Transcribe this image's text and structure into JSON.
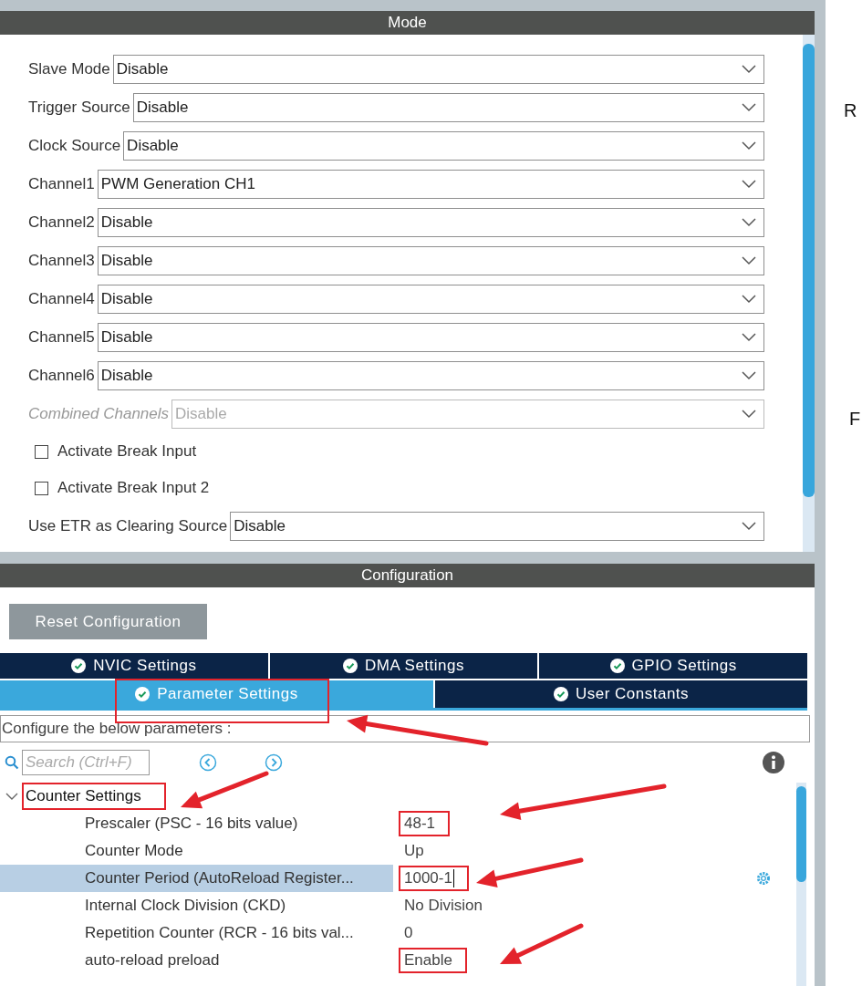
{
  "mode_panel": {
    "title": "Mode",
    "fields": [
      {
        "kind": "select",
        "label": "Slave Mode",
        "value": "Disable",
        "disabled": false
      },
      {
        "kind": "select",
        "label": "Trigger Source",
        "value": "Disable",
        "disabled": false
      },
      {
        "kind": "select",
        "label": "Clock Source",
        "value": "Disable",
        "disabled": false
      },
      {
        "kind": "select",
        "label": "Channel1",
        "value": "PWM Generation CH1",
        "disabled": false
      },
      {
        "kind": "select",
        "label": "Channel2",
        "value": "Disable",
        "disabled": false
      },
      {
        "kind": "select",
        "label": "Channel3",
        "value": "Disable",
        "disabled": false
      },
      {
        "kind": "select",
        "label": "Channel4",
        "value": "Disable",
        "disabled": false
      },
      {
        "kind": "select",
        "label": "Channel5",
        "value": "Disable",
        "disabled": false
      },
      {
        "kind": "select",
        "label": "Channel6",
        "value": "Disable",
        "disabled": false
      },
      {
        "kind": "select",
        "label": "Combined Channels",
        "value": "Disable",
        "disabled": true
      },
      {
        "kind": "checkbox",
        "label": "Activate Break Input",
        "checked": false
      },
      {
        "kind": "checkbox",
        "label": "Activate Break Input 2",
        "checked": false
      },
      {
        "kind": "select",
        "label": "Use ETR as Clearing Source",
        "value": "Disable",
        "disabled": false
      }
    ]
  },
  "config_panel": {
    "title": "Configuration",
    "reset_button": "Reset Configuration",
    "tab_rows": [
      [
        {
          "label": "NVIC Settings",
          "selected": false,
          "highlighted": false
        },
        {
          "label": "DMA Settings",
          "selected": false,
          "highlighted": false
        },
        {
          "label": "GPIO Settings",
          "selected": false,
          "highlighted": false
        }
      ],
      [
        {
          "label": "Parameter Settings",
          "selected": true,
          "highlighted": true
        },
        {
          "label": "User Constants",
          "selected": false,
          "highlighted": false
        }
      ]
    ],
    "description": "Configure the below parameters :",
    "search": {
      "placeholder": "Search (Ctrl+F)"
    },
    "tree": [
      {
        "label": "Counter Settings",
        "expanded": true,
        "highlighted": true,
        "children": [
          {
            "label": "Prescaler (PSC - 16 bits value)",
            "value": "48-1",
            "selected": false,
            "highlighted": true
          },
          {
            "label": "Counter Mode",
            "value": "Up",
            "selected": false,
            "highlighted": false
          },
          {
            "label": "Counter Period (AutoReload Register...",
            "value": "1000-1",
            "selected": true,
            "highlighted": true
          },
          {
            "label": "Internal Clock Division (CKD)",
            "value": "No Division",
            "selected": false,
            "highlighted": false
          },
          {
            "label": "Repetition Counter (RCR - 16 bits val...",
            "value": "0",
            "selected": false,
            "highlighted": false
          },
          {
            "label": "auto-reload preload",
            "value": "Enable",
            "selected": false,
            "highlighted": true
          }
        ]
      }
    ]
  },
  "side_fragments": [
    "R",
    "F"
  ]
}
